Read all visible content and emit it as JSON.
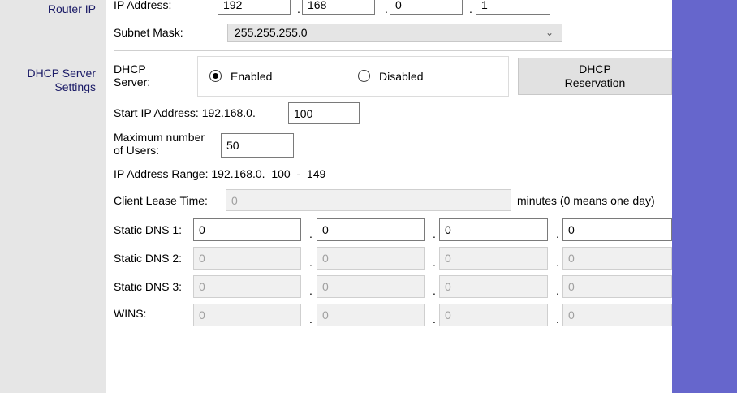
{
  "sections": {
    "router_ip": "Router IP",
    "dhcp_server_line1": "DHCP Server",
    "dhcp_server_line2": "Settings"
  },
  "router": {
    "ip_label": "IP Address:",
    "ip": [
      "192",
      "168",
      "0",
      "1"
    ],
    "subnet_label": "Subnet Mask:",
    "subnet_value": "255.255.255.0"
  },
  "dhcp": {
    "server_label_line1": "DHCP",
    "server_label_line2": "Server:",
    "enabled_label": "Enabled",
    "disabled_label": "Disabled",
    "selected": "Enabled",
    "reservation_line1": "DHCP",
    "reservation_line2": "Reservation",
    "start_ip_label": "Start IP Address:",
    "start_ip_prefix": "192.168.0.",
    "start_ip_value": "100",
    "max_users_line1": "Maximum number",
    "max_users_line2": "of Users:",
    "max_users_value": "50",
    "range_label": "IP Address Range:",
    "range_value": "192.168.0.  100  -  149",
    "lease_label": "Client Lease Time:",
    "lease_value": "0",
    "lease_suffix": "minutes (0 means one day)",
    "dns1_label": "Static DNS 1:",
    "dns1": [
      "0",
      "0",
      "0",
      "0"
    ],
    "dns2_label": "Static DNS 2:",
    "dns2": [
      "0",
      "0",
      "0",
      "0"
    ],
    "dns3_label": "Static DNS 3:",
    "dns3": [
      "0",
      "0",
      "0",
      "0"
    ],
    "wins_label": "WINS:",
    "wins": [
      "0",
      "0",
      "0",
      "0"
    ]
  },
  "icons": {
    "dropdown": "chevron-down-icon"
  },
  "colors": {
    "sidebar_bg": "#e6e6e6",
    "right_panel": "#6666cc",
    "label_text": "#1a1a66"
  }
}
